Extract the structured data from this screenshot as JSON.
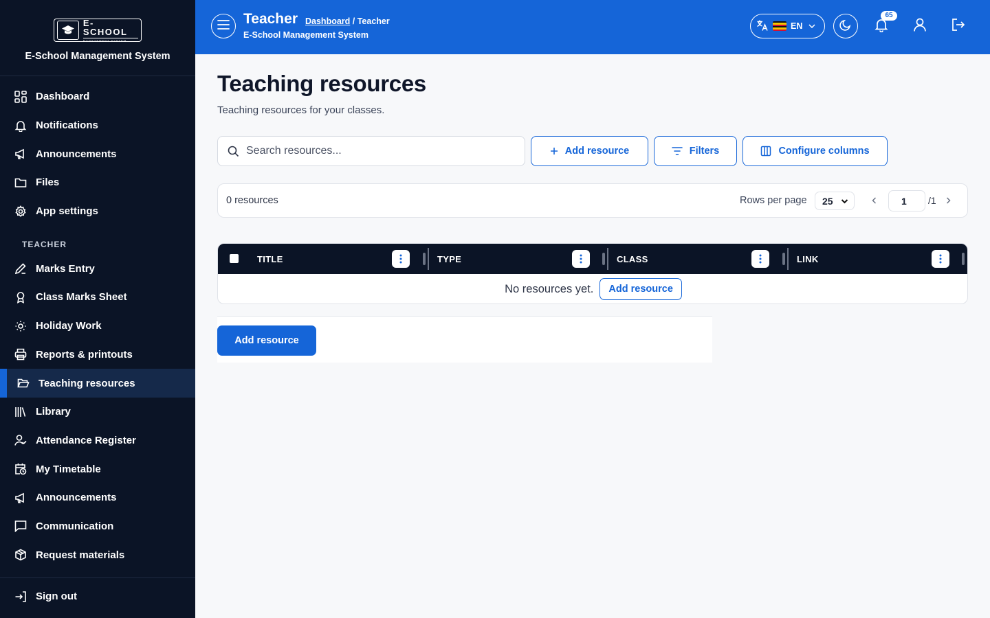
{
  "brand": {
    "logo_main": "E-SCHOOL",
    "logo_sub": "MANAGEMENT SYSTEM",
    "name": "E-School Management System"
  },
  "sidebar": {
    "items": [
      {
        "label": "Dashboard",
        "icon": "dashboard-grid-icon"
      },
      {
        "label": "Notifications",
        "icon": "bell-icon"
      },
      {
        "label": "Announcements",
        "icon": "megaphone-icon"
      },
      {
        "label": "Files",
        "icon": "folder-icon"
      },
      {
        "label": "App settings",
        "icon": "gear-icon"
      }
    ],
    "section": "TEACHER",
    "teacher_items": [
      {
        "label": "Marks Entry",
        "icon": "pencil-icon"
      },
      {
        "label": "Class Marks Sheet",
        "icon": "award-icon"
      },
      {
        "label": "Holiday Work",
        "icon": "sun-icon"
      },
      {
        "label": "Reports & printouts",
        "icon": "printer-icon"
      },
      {
        "label": "Teaching resources",
        "icon": "folder-open-icon",
        "active": true
      },
      {
        "label": "Library",
        "icon": "library-icon"
      },
      {
        "label": "Attendance Register",
        "icon": "user-check-icon"
      },
      {
        "label": "My Timetable",
        "icon": "calendar-clock-icon"
      },
      {
        "label": "Announcements",
        "icon": "megaphone-icon"
      },
      {
        "label": "Communication",
        "icon": "chat-icon"
      },
      {
        "label": "Request materials",
        "icon": "package-icon"
      }
    ],
    "signout": "Sign out"
  },
  "header": {
    "title": "Teacher",
    "breadcrumb_link": "Dashboard",
    "breadcrumb_current": "/ Teacher",
    "subtitle": "E-School Management System",
    "language": "EN",
    "notification_count": "65"
  },
  "main": {
    "title": "Teaching resources",
    "subtitle": "Teaching resources for your classes.",
    "search_placeholder": "Search resources...",
    "add_resource": "Add resource",
    "filters": "Filters",
    "configure_columns": "Configure columns",
    "count": "0 resources",
    "rows_per_page_label": "Rows per page",
    "rows_per_page": "25",
    "page": "1",
    "page_total": "/1",
    "columns": [
      "TITLE",
      "TYPE",
      "CLASS",
      "LINK"
    ],
    "empty_text": "No resources yet.",
    "empty_button": "Add resource",
    "bottom_button": "Add resource"
  },
  "colors": {
    "primary": "#1565d8",
    "sidebar_bg": "#0b1426",
    "active_bg": "#15294a"
  }
}
